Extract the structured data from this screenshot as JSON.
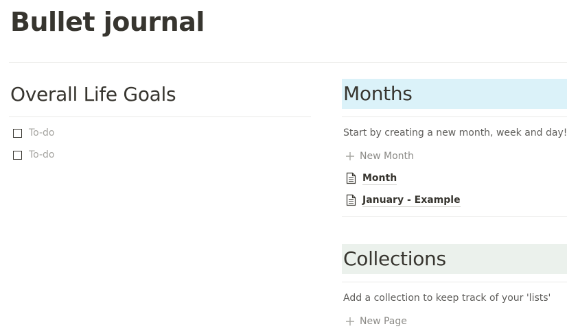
{
  "page": {
    "title": "Bullet journal"
  },
  "left_column": {
    "heading": "Overall Life Goals",
    "todos": [
      {
        "placeholder": "To-do",
        "checked": false
      },
      {
        "placeholder": "To-do",
        "checked": false
      }
    ]
  },
  "months": {
    "heading": "Months",
    "heading_bg": "#dbf2f9",
    "description": "Start by creating a new month, week and day!",
    "new_label": "New Month",
    "pages": [
      {
        "title": "Month",
        "icon": "page-icon"
      },
      {
        "title": "January - Example",
        "icon": "page-icon"
      }
    ]
  },
  "collections": {
    "heading": "Collections",
    "heading_bg": "#ebf1ec",
    "description": "Add a collection to keep track of your 'lists'",
    "new_label": "New Page"
  },
  "colors": {
    "text": "#37352f",
    "muted": "#a6a5a1",
    "divider": "#e9e9e7"
  }
}
